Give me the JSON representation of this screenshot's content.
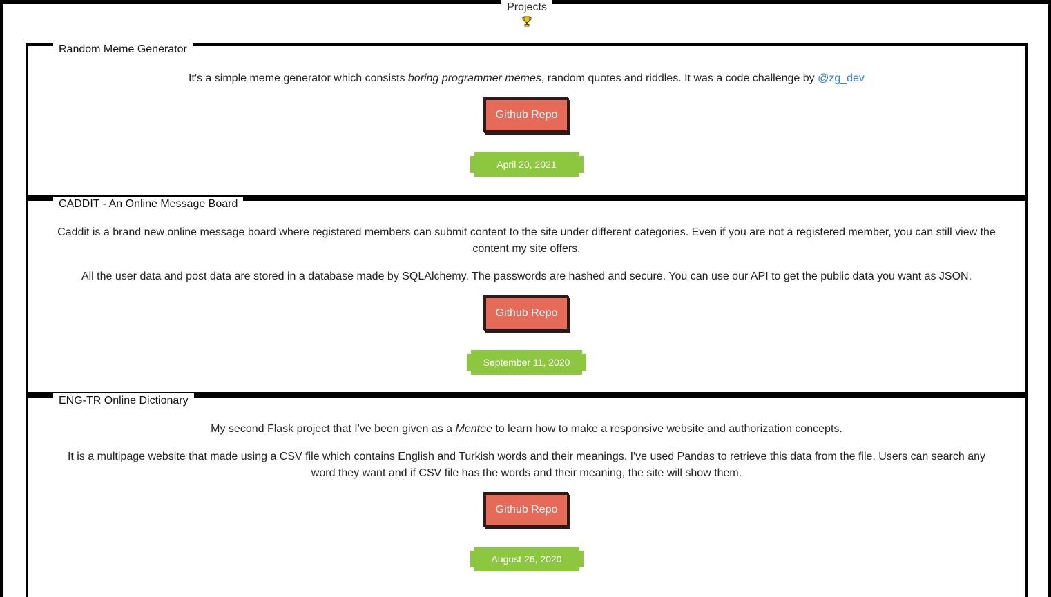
{
  "header": {
    "title": "Projects",
    "icon": "trophy-icon"
  },
  "projects": [
    {
      "title": "Random Meme Generator",
      "paragraphs": [
        {
          "before": "It's a simple meme generator which consists ",
          "em": "boring programmer memes",
          "after": ", random quotes and riddles. It was a code challenge by ",
          "link": "@zg_dev"
        }
      ],
      "button": "Github Repo",
      "date": "April 20, 2021"
    },
    {
      "title": "CADDIT - An Online Message Board",
      "paragraphs": [
        "Caddit is a brand new online message board where registered members can submit content to the site under different categories. Even if you are not a registered member, you can still view the content my site offers.",
        "All the user data and post data are stored in a database made by SQLAlchemy. The passwords are hashed and secure. You can use our API to get the public data you want as JSON."
      ],
      "button": "Github Repo",
      "date": "September 11, 2020"
    },
    {
      "title": "ENG-TR Online Dictionary",
      "paragraphs": [
        {
          "before": "My second Flask project that I've been given as a ",
          "em": "Mentee",
          "after": " to learn how to make a responsive website and authorization concepts."
        },
        "It is a multipage website that made using a CSV file which contains English and Turkish words and their meanings. I've used Pandas to retrieve this data from the file. Users can search any word they want and if CSV file has the words and their meaning, the site will show them."
      ],
      "button": "Github Repo",
      "date": "August 26, 2020"
    }
  ],
  "colors": {
    "button_bg": "#e56a57",
    "date_bg": "#8dc63f",
    "link": "#2f7fde",
    "border": "#000000"
  }
}
